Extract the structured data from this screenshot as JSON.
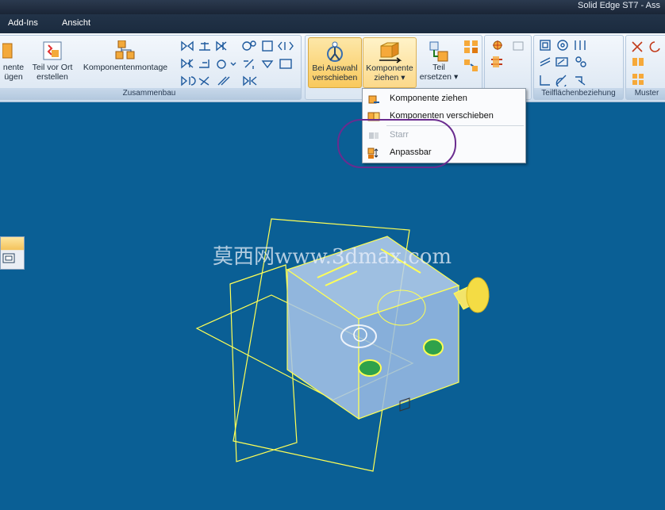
{
  "window": {
    "title": "Solid Edge ST7 - Ass"
  },
  "menu": {
    "items": [
      "Add-Ins",
      "Ansicht"
    ]
  },
  "ribbon": {
    "groups": {
      "zusammenbau": "Zusammenbau",
      "teilflaechen": "Teilflächenbeziehung",
      "muster": "Muster"
    },
    "buttons": {
      "komponente_fuegen": [
        "nente",
        "ügen"
      ],
      "teil_vor_ort": [
        "Teil vor Ort",
        "erstellen"
      ],
      "komponentenmontage": "Komponentenmontage",
      "bei_auswahl": [
        "Bei Auswahl",
        "verschieben"
      ],
      "komponente_ziehen": [
        "Komponente",
        "ziehen"
      ],
      "teil_ersetzen": [
        "Teil",
        "ersetzen"
      ]
    }
  },
  "dropdown": {
    "items": [
      {
        "label": "Komponente ziehen",
        "enabled": true
      },
      {
        "label": "Komponenten verschieben",
        "enabled": true
      },
      {
        "label": "Starr",
        "enabled": false
      },
      {
        "label": "Anpassbar",
        "enabled": true
      }
    ]
  },
  "watermark": "莫西网www.3dmax.com",
  "colors": {
    "viewport": "#0a5f95",
    "wireframe": "#ffff55",
    "highlight": "#f9c95c",
    "annotation": "#6a2c8f"
  }
}
